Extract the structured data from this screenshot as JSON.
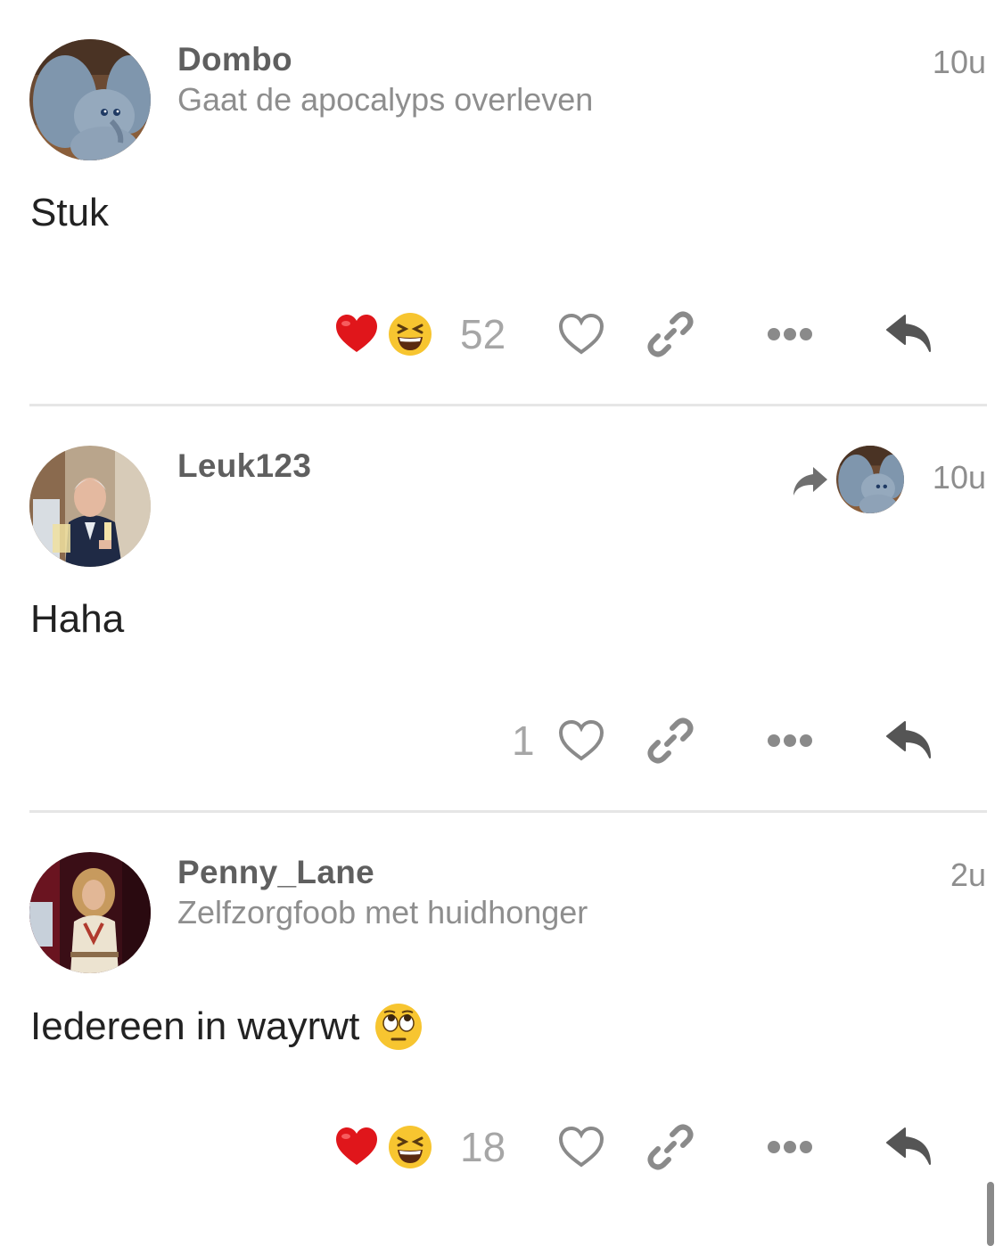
{
  "posts": [
    {
      "username": "Dombo",
      "user_title": "Gaat de apocalyps overleven",
      "time": "10u",
      "body": "Stuk",
      "reactions": [
        "heart",
        "grinning-squinting"
      ],
      "reaction_count": "52",
      "avatar": "dumbo-elephant"
    },
    {
      "username": "Leuk123",
      "user_title": "",
      "time": "10u",
      "body": "Haha",
      "reply_to_avatar": "dumbo-elephant",
      "reactions": [],
      "reaction_count": "1",
      "avatar": "man-with-champagne"
    },
    {
      "username": "Penny_Lane",
      "user_title": "Zelfzorgfoob met huidhonger",
      "time": "2u",
      "body": "Iedereen in wayrwt",
      "body_emoji": "face-with-rolling-eyes",
      "reactions": [
        "heart",
        "grinning-squinting"
      ],
      "reaction_count": "18",
      "avatar": "woman-on-stage"
    }
  ],
  "icons": {
    "like": "heart-outline-icon",
    "link": "link-icon",
    "more": "ellipsis-icon",
    "reply": "reply-icon",
    "share": "share-arrow-icon"
  },
  "colors": {
    "username": "#5f5f5f",
    "muted": "#8e8e8e",
    "body": "#222222",
    "icon": "#8a8a8a",
    "reply_icon": "#555555",
    "divider": "#e6e6e6"
  }
}
